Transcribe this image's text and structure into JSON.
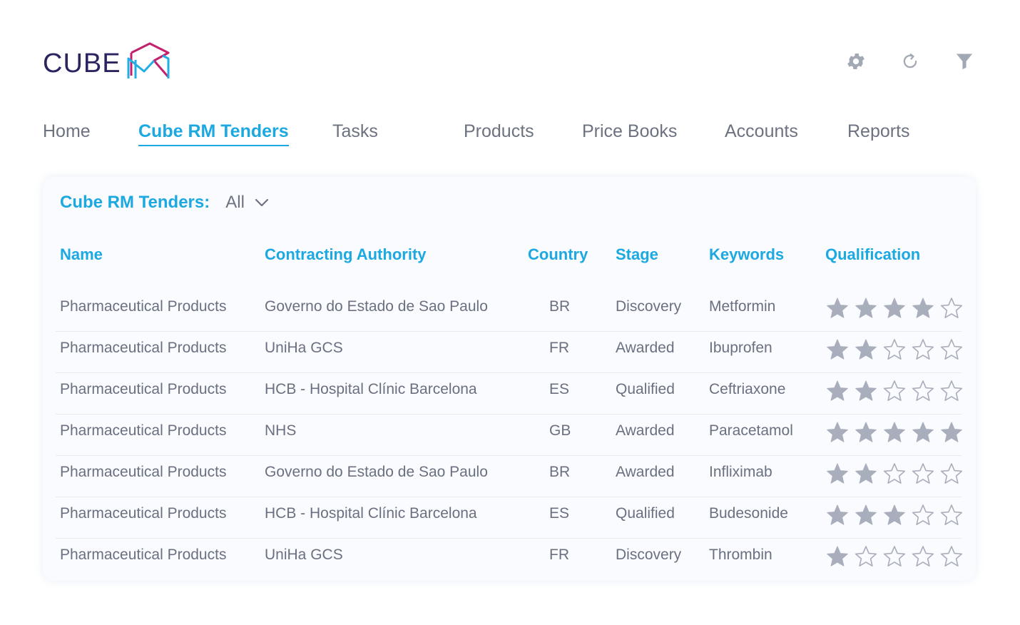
{
  "brand": {
    "logo_text": "CUBE",
    "colors": {
      "navy": "#2a2560",
      "accent": "#1ca8e0",
      "magenta": "#c4216d",
      "muted_text": "#6c7280",
      "star": "#a9aebc"
    }
  },
  "toolbar": {
    "icons": [
      "gear-icon",
      "refresh-icon",
      "filter-icon"
    ]
  },
  "nav": {
    "items": [
      {
        "label": "Home",
        "active": false
      },
      {
        "label": "Cube RM Tenders",
        "active": true
      },
      {
        "label": "Tasks",
        "active": false
      },
      {
        "label": "Products",
        "active": false
      },
      {
        "label": "Price Books",
        "active": false
      },
      {
        "label": "Accounts",
        "active": false
      },
      {
        "label": "Reports",
        "active": false
      }
    ]
  },
  "list": {
    "title": "Cube RM Tenders:",
    "view_selected": "All",
    "columns": [
      "Name",
      "Contracting Authority",
      "Country",
      "Stage",
      "Keywords",
      "Qualification"
    ],
    "max_rating": 5,
    "rows": [
      {
        "name": "Pharmaceutical Products",
        "authority": "Governo do Estado de Sao Paulo",
        "country": "BR",
        "stage": "Discovery",
        "keyword": "Metformin",
        "rating": 4
      },
      {
        "name": "Pharmaceutical Products",
        "authority": "UniHa GCS",
        "country": "FR",
        "stage": "Awarded",
        "keyword": "Ibuprofen",
        "rating": 2
      },
      {
        "name": "Pharmaceutical Products",
        "authority": "HCB - Hospital Clínic Barcelona",
        "country": "ES",
        "stage": "Qualified",
        "keyword": "Ceftriaxone",
        "rating": 2
      },
      {
        "name": "Pharmaceutical Products",
        "authority": "NHS",
        "country": "GB",
        "stage": "Awarded",
        "keyword": "Paracetamol",
        "rating": 5
      },
      {
        "name": "Pharmaceutical Products",
        "authority": "Governo do Estado de Sao Paulo",
        "country": "BR",
        "stage": "Awarded",
        "keyword": "Infliximab",
        "rating": 2
      },
      {
        "name": "Pharmaceutical Products",
        "authority": "HCB - Hospital Clínic Barcelona",
        "country": "ES",
        "stage": "Qualified",
        "keyword": "Budesonide",
        "rating": 3
      },
      {
        "name": "Pharmaceutical Products",
        "authority": "UniHa GCS",
        "country": "FR",
        "stage": "Discovery",
        "keyword": "Thrombin",
        "rating": 1
      }
    ]
  }
}
